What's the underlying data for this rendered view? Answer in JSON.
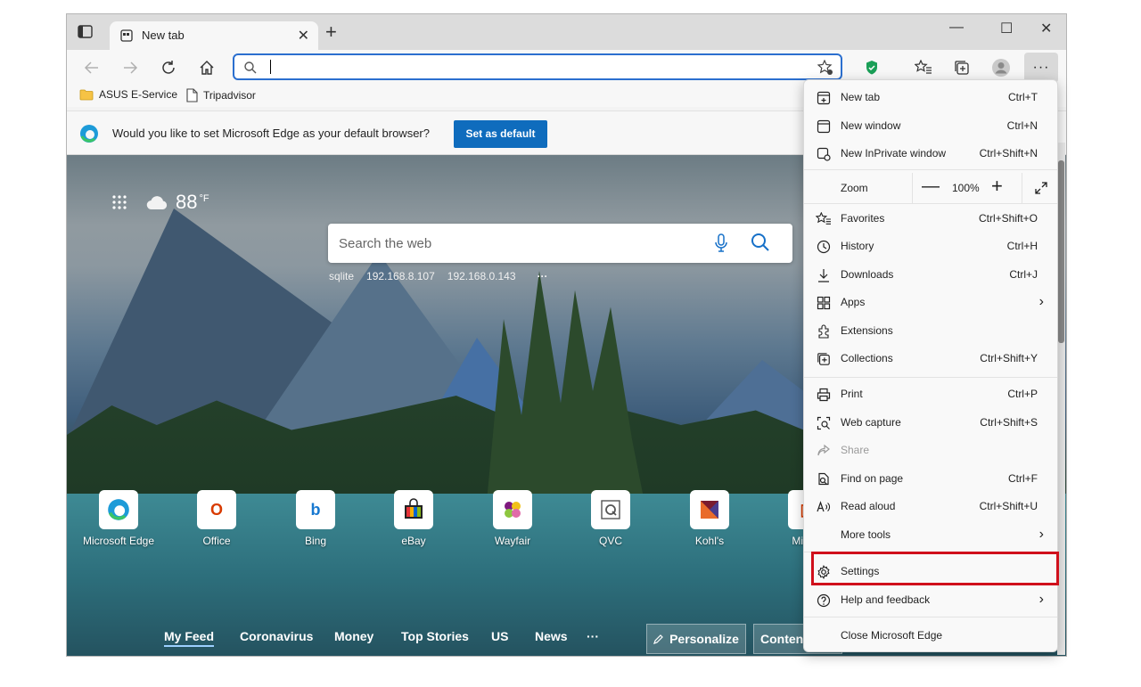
{
  "tab": {
    "title": "New tab",
    "close": "✕",
    "new": "+"
  },
  "window": {
    "minimize": "—",
    "maximize": "☐",
    "close": "✕"
  },
  "toolbar": {
    "address_value": "",
    "address_placeholder": ""
  },
  "bookmarks": [
    {
      "label": "ASUS E-Service"
    },
    {
      "label": "Tripadvisor"
    }
  ],
  "infobar": {
    "message": "Would you like to set Microsoft Edge as your default browser?",
    "button": "Set as default"
  },
  "newtab": {
    "temperature": "88",
    "temperature_unit": "°F",
    "search_placeholder": "Search the web",
    "quick_links": [
      "sqlite",
      "192.168.8.107",
      "192.168.0.143",
      "···"
    ],
    "tiles": [
      {
        "label": "Microsoft Edge",
        "icon": "edge-icon",
        "glyph": "e",
        "color": "#0f7fcf"
      },
      {
        "label": "Office",
        "icon": "office-icon",
        "glyph": "O",
        "color": "#d83b01"
      },
      {
        "label": "Bing",
        "icon": "bing-icon",
        "glyph": "b",
        "color": "#1778d0"
      },
      {
        "label": "eBay",
        "icon": "ebay-icon",
        "glyph": "▦",
        "color": "#222222"
      },
      {
        "label": "Wayfair",
        "icon": "wayfair-icon",
        "glyph": "✿",
        "color": "#7f187f"
      },
      {
        "label": "QVC",
        "icon": "qvc-icon",
        "glyph": "Q",
        "color": "#555555"
      },
      {
        "label": "Kohl's",
        "icon": "kohls-icon",
        "glyph": "K",
        "color": "#7a1b2f"
      },
      {
        "label": "Micros",
        "icon": "microsoft-icon",
        "glyph": "▣",
        "color": "#d83b01"
      }
    ],
    "feed": {
      "tabs": [
        "My Feed",
        "Coronavirus",
        "Money",
        "Top Stories",
        "US",
        "News",
        "···"
      ],
      "personalize": "Personalize",
      "content": "Content"
    }
  },
  "menu": {
    "items_top": [
      {
        "label": "New tab",
        "shortcut": "Ctrl+T",
        "icon": "new-tab-icon"
      },
      {
        "label": "New window",
        "shortcut": "Ctrl+N",
        "icon": "new-window-icon"
      },
      {
        "label": "New InPrivate window",
        "shortcut": "Ctrl+Shift+N",
        "icon": "inprivate-icon"
      }
    ],
    "zoom": {
      "label": "Zoom",
      "minus": "—",
      "value": "100%",
      "plus": "+"
    },
    "items_mid": [
      {
        "label": "Favorites",
        "shortcut": "Ctrl+Shift+O",
        "icon": "favorites-icon"
      },
      {
        "label": "History",
        "shortcut": "Ctrl+H",
        "icon": "history-icon"
      },
      {
        "label": "Downloads",
        "shortcut": "Ctrl+J",
        "icon": "downloads-icon"
      },
      {
        "label": "Apps",
        "shortcut": "",
        "icon": "apps-icon",
        "submenu": true
      },
      {
        "label": "Extensions",
        "shortcut": "",
        "icon": "extensions-icon"
      },
      {
        "label": "Collections",
        "shortcut": "Ctrl+Shift+Y",
        "icon": "collections-icon"
      }
    ],
    "items_tools": [
      {
        "label": "Print",
        "shortcut": "Ctrl+P",
        "icon": "print-icon"
      },
      {
        "label": "Web capture",
        "shortcut": "Ctrl+Shift+S",
        "icon": "web-capture-icon"
      },
      {
        "label": "Share",
        "shortcut": "",
        "icon": "share-icon",
        "disabled": true
      },
      {
        "label": "Find on page",
        "shortcut": "Ctrl+F",
        "icon": "find-icon"
      },
      {
        "label": "Read aloud",
        "shortcut": "Ctrl+Shift+U",
        "icon": "read-aloud-icon"
      },
      {
        "label": "More tools",
        "shortcut": "",
        "icon": "",
        "submenu": true
      }
    ],
    "settings": {
      "label": "Settings",
      "icon": "gear-icon"
    },
    "help": {
      "label": "Help and feedback",
      "icon": "help-icon",
      "submenu": true
    },
    "close": {
      "label": "Close Microsoft Edge"
    },
    "highlight_color": "#d0101c"
  }
}
